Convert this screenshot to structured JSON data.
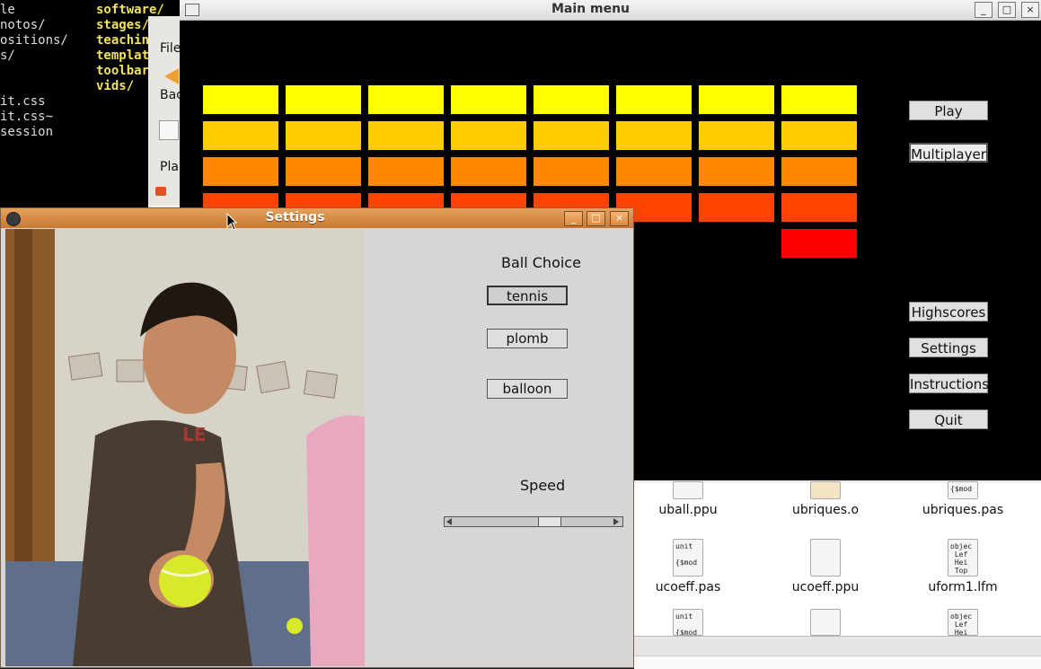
{
  "terminal": {
    "left_lines": [
      "le",
      "notos/",
      "ositions/",
      "s/",
      "",
      "it.css",
      "it.css~",
      "session"
    ],
    "right_lines": [
      "software/",
      "stages/",
      "teaching",
      "template",
      "toolbars",
      "vids/"
    ]
  },
  "file_manager": {
    "menu_file": "File",
    "back_label": "Bac",
    "places_label": "Pla",
    "files": [
      {
        "name": "uball.ppu",
        "icon": "document-icon",
        "preview": ""
      },
      {
        "name": "ubriques.o",
        "icon": "object-file-icon",
        "preview": ""
      },
      {
        "name": "ubriques.pas",
        "icon": "pascal-source-icon",
        "preview": "{$mod"
      },
      {
        "name": "ucoeff.pas",
        "icon": "pascal-source-icon",
        "preview": "unit\n\n{$mod"
      },
      {
        "name": "ucoeff.ppu",
        "icon": "document-icon",
        "preview": ""
      },
      {
        "name": "uform1.lfm",
        "icon": "form-file-icon",
        "preview": "objec\n Lef\n Hei\n Top"
      }
    ],
    "partial_files": [
      {
        "icon": "pascal-source-icon",
        "preview": "unit\n\n{$mod"
      },
      {
        "icon": "document-icon",
        "preview": ""
      },
      {
        "icon": "form-file-icon",
        "preview": "objec\n Lef\n Hei"
      }
    ]
  },
  "main_menu": {
    "title": "Main menu",
    "buttons": {
      "play": "Play",
      "multiplayer": "Multiplayer",
      "highscores": "Highscores",
      "settings": "Settings",
      "instructions": "Instructions",
      "quit": "Quit"
    },
    "brick_rows": [
      {
        "color": "#ffff00",
        "count": 8
      },
      {
        "color": "#ffcc00",
        "count": 8
      },
      {
        "color": "#ff8800",
        "count": 8
      },
      {
        "color": "#ff4400",
        "count": 8
      },
      {
        "color": "#ff0000",
        "pattern": [
          1,
          1,
          1,
          1,
          1,
          0,
          0,
          1
        ]
      }
    ]
  },
  "settings": {
    "title": "Settings",
    "ball_choice_label": "Ball Choice",
    "balls": [
      "tennis",
      "plomb",
      "balloon"
    ],
    "selected_ball": "tennis",
    "speed_label": "Speed",
    "speed_fraction": 0.6
  },
  "window_controls": {
    "minimize": "_",
    "maximize": "□",
    "close": "×"
  }
}
